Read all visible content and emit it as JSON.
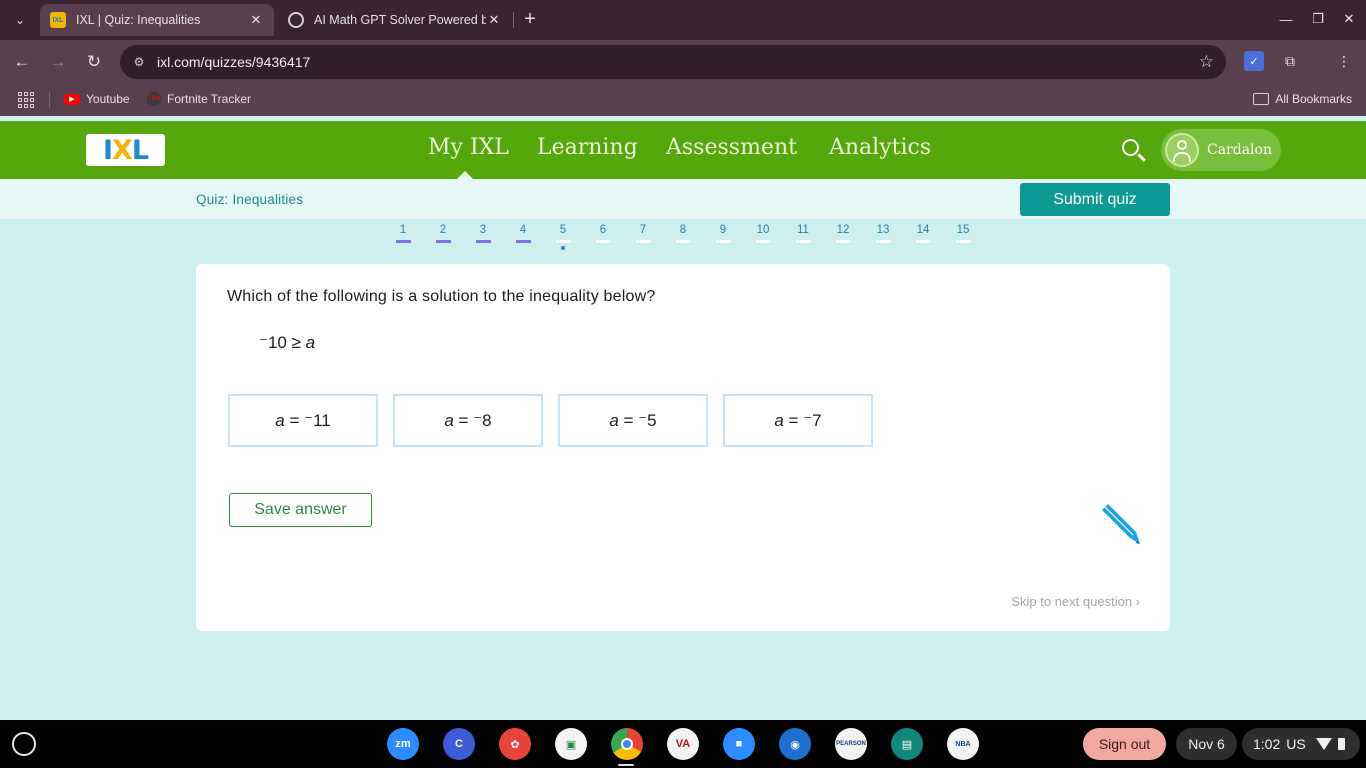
{
  "browser": {
    "tabs": [
      {
        "title": "IXL | Quiz: Inequalities",
        "favicon": "ixl-favicon",
        "active": true
      },
      {
        "title": "AI Math GPT Solver Powered b",
        "favicon": "ai-math-favicon",
        "active": false
      }
    ],
    "url": "ixl.com/quizzes/9436417",
    "bookmarks": [
      {
        "label": "Youtube",
        "icon": "youtube-icon"
      },
      {
        "label": "Fortnite Tracker",
        "icon": "fortnite-tracker-icon"
      }
    ],
    "all_bookmarks_label": "All Bookmarks"
  },
  "ixl": {
    "logo_text": "IXL",
    "nav": [
      {
        "label": "My IXL",
        "active": true
      },
      {
        "label": "Learning"
      },
      {
        "label": "Assessment"
      },
      {
        "label": "Analytics"
      }
    ],
    "user_name": "Cardalon",
    "quiz_title": "Quiz: Inequalities",
    "submit_label": "Submit quiz",
    "question_numbers": [
      "1",
      "2",
      "3",
      "4",
      "5",
      "6",
      "7",
      "8",
      "9",
      "10",
      "11",
      "12",
      "13",
      "14",
      "15"
    ],
    "answered_count": 4,
    "current_question": 5,
    "question_text": "Which of the following is a solution to the inequality below?",
    "expression": {
      "left": "⁻10 ≥ ",
      "variable": "a"
    },
    "options": [
      {
        "var": "a",
        "rest": " = ⁻11"
      },
      {
        "var": "a",
        "rest": " = ⁻8"
      },
      {
        "var": "a",
        "rest": " = ⁻5"
      },
      {
        "var": "a",
        "rest": " = ⁻7"
      }
    ],
    "save_label": "Save answer",
    "skip_label": "Skip to next question ›"
  },
  "shelf": {
    "apps": [
      "zoom",
      "C",
      "paint",
      "classroom",
      "chrome",
      "VA",
      "camera-video",
      "camera",
      "pearson",
      "news",
      "nba"
    ],
    "sign_out": "Sign out",
    "date": "Nov 6",
    "time": "1:02",
    "locale": "US"
  },
  "colors": {
    "ixl_green": "#56a70b",
    "teal": "#0d9a96",
    "answered_bar": "#7b74e0"
  }
}
